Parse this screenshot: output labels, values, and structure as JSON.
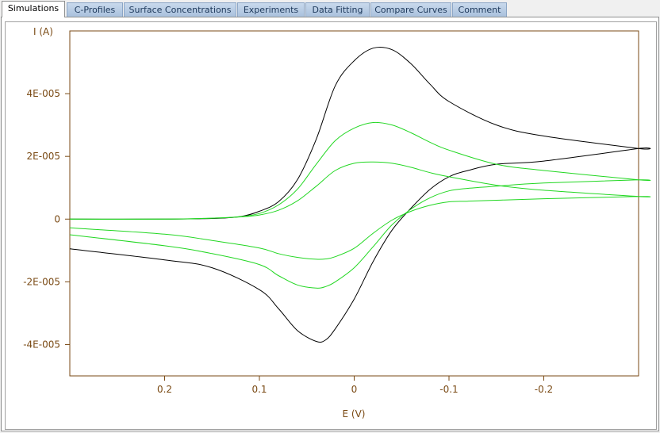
{
  "tabs": [
    {
      "label": "Simulations",
      "active": true
    },
    {
      "label": "C-Profiles",
      "active": false
    },
    {
      "label": "Surface Concentrations",
      "active": false
    },
    {
      "label": "Experiments",
      "active": false
    },
    {
      "label": "Data Fitting",
      "active": false
    },
    {
      "label": "Compare Curves",
      "active": false
    },
    {
      "label": "Comment",
      "active": false
    }
  ],
  "colors": {
    "axis": "#7a4a14",
    "series_black": "#000000",
    "series_green": "#22d722"
  },
  "chart_data": {
    "type": "line",
    "xlabel": "E (V)",
    "ylabel": "I (A)",
    "xlim": [
      0.3,
      -0.3
    ],
    "ylim": [
      -5e-05,
      6e-05
    ],
    "x_ticks": [
      0.2,
      0.1,
      0,
      -0.1,
      -0.2
    ],
    "x_tick_labels": [
      "0.2",
      "0.1",
      "0",
      "-0.1",
      "-0.2"
    ],
    "y_ticks": [
      4e-05,
      2e-05,
      0,
      -2e-05,
      -4e-05
    ],
    "y_tick_labels": [
      "4E-005",
      "2E-005",
      "0",
      "-2E-005",
      "-4E-005"
    ],
    "grid": false,
    "series": [
      {
        "color": "black",
        "x": [
          0.3,
          0.2,
          0.15,
          0.12,
          0.1,
          0.08,
          0.06,
          0.04,
          0.02,
          0.0,
          -0.02,
          -0.04,
          -0.06,
          -0.08,
          -0.1,
          -0.15,
          -0.2,
          -0.3,
          -0.3,
          -0.2,
          -0.15,
          -0.12,
          -0.1,
          -0.08,
          -0.06,
          -0.04,
          -0.02,
          0.0,
          0.02,
          0.03,
          0.04,
          0.06,
          0.08,
          0.1,
          0.15,
          0.2,
          0.3
        ],
        "y": [
          0.0,
          0.0,
          2e-07,
          8e-07,
          2.5e-06,
          5.5e-06,
          1.25e-05,
          2.55e-05,
          4.25e-05,
          5.05e-05,
          5.45e-05,
          5.4e-05,
          4.95e-05,
          4.3e-05,
          3.75e-05,
          3e-05,
          2.65e-05,
          2.25e-05,
          2.25e-05,
          1.85e-05,
          1.75e-05,
          1.55e-05,
          1.35e-05,
          9.5e-06,
          3.5e-06,
          -3.5e-06,
          -1.35e-05,
          -2.55e-05,
          -3.5e-05,
          -3.85e-05,
          -3.9e-05,
          -3.55e-05,
          -2.85e-05,
          -2.25e-05,
          -1.55e-05,
          -1.3e-05,
          -9.5e-06
        ]
      },
      {
        "color": "green",
        "x": [
          0.3,
          0.2,
          0.15,
          0.12,
          0.1,
          0.08,
          0.06,
          0.04,
          0.02,
          0.0,
          -0.02,
          -0.04,
          -0.06,
          -0.08,
          -0.1,
          -0.15,
          -0.2,
          -0.3,
          -0.3,
          -0.2,
          -0.15,
          -0.12,
          -0.1,
          -0.08,
          -0.06,
          -0.04,
          -0.02,
          0.0,
          0.02,
          0.03,
          0.04,
          0.06,
          0.08,
          0.1,
          0.15,
          0.2,
          0.3
        ],
        "y": [
          0.0,
          0.0,
          3e-07,
          8e-07,
          1.8e-06,
          4.5e-06,
          9.5e-06,
          1.75e-05,
          2.5e-05,
          2.9e-05,
          3.08e-05,
          3e-05,
          2.75e-05,
          2.45e-05,
          2.2e-05,
          1.75e-05,
          1.55e-05,
          1.25e-05,
          1.25e-05,
          1.15e-05,
          1.05e-05,
          9.8e-06,
          9e-06,
          6.8e-06,
          3.2e-06,
          -1.8e-06,
          -8.8e-06,
          -1.55e-05,
          -2e-05,
          -2.15e-05,
          -2.2e-05,
          -2.1e-05,
          -1.8e-05,
          -1.45e-05,
          -1.1e-05,
          -8.5e-06,
          -5e-06
        ]
      },
      {
        "color": "green",
        "x": [
          0.3,
          0.2,
          0.15,
          0.12,
          0.1,
          0.08,
          0.06,
          0.04,
          0.02,
          0.0,
          -0.02,
          -0.04,
          -0.06,
          -0.08,
          -0.1,
          -0.15,
          -0.2,
          -0.3,
          -0.3,
          -0.2,
          -0.15,
          -0.12,
          -0.1,
          -0.08,
          -0.06,
          -0.04,
          -0.02,
          0.0,
          0.02,
          0.03,
          0.04,
          0.06,
          0.08,
          0.1,
          0.15,
          0.2,
          0.3
        ],
        "y": [
          0.0,
          0.0,
          3e-07,
          7e-07,
          1.3e-06,
          2.8e-06,
          5.8e-06,
          1.05e-05,
          1.55e-05,
          1.78e-05,
          1.82e-05,
          1.78e-05,
          1.65e-05,
          1.48e-05,
          1.35e-05,
          1.08e-05,
          9.2e-06,
          7.2e-06,
          7.2e-06,
          6.5e-06,
          6e-06,
          5.7e-06,
          5.5e-06,
          4.4e-06,
          2.5e-06,
          -3e-07,
          -4.5e-06,
          -9.3e-06,
          -1.2e-05,
          -1.27e-05,
          -1.28e-05,
          -1.22e-05,
          -1.1e-05,
          -9.2e-06,
          -6.8e-06,
          -4.8e-06,
          -2.8e-06
        ]
      }
    ]
  }
}
